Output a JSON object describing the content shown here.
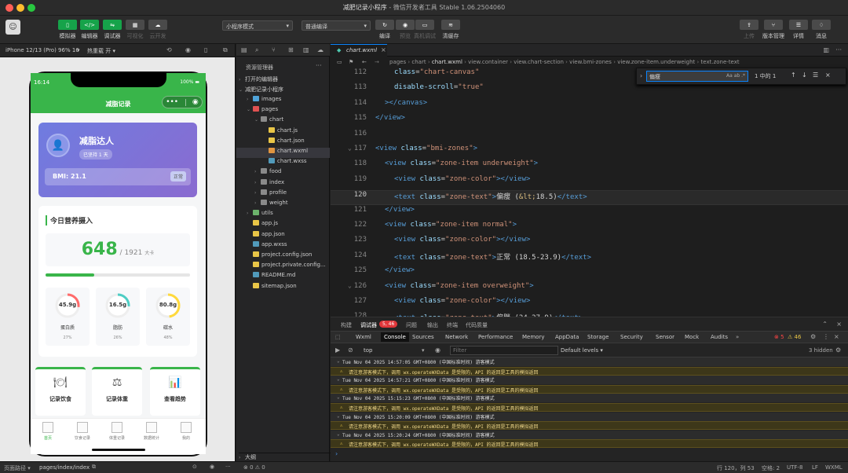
{
  "window": {
    "title": "减肥记录小程序",
    "subtitle": "微信开发者工具 Stable 1.06.2504060"
  },
  "toolbar": {
    "left": [
      {
        "label": "模拟器",
        "icon": "phone-icon",
        "active": true
      },
      {
        "label": "编辑器",
        "icon": "code-icon",
        "active": true
      },
      {
        "label": "调试器",
        "icon": "debug-icon",
        "active": true
      },
      {
        "label": "可视化",
        "icon": "layout-icon",
        "active": false
      },
      {
        "label": "云开发",
        "icon": "cloud-icon",
        "active": false
      }
    ],
    "mode_select": "小程序模式",
    "compile_select": "普通编译",
    "center": [
      {
        "label": "编译",
        "icon": "refresh-icon"
      },
      {
        "label": "预览",
        "icon": "eye-icon"
      },
      {
        "label": "真机调试",
        "icon": "devices-icon"
      },
      {
        "label": "清缓存",
        "icon": "layers-icon"
      }
    ],
    "right": [
      {
        "label": "上传",
        "icon": "upload-icon"
      },
      {
        "label": "版本管理",
        "icon": "branch-icon"
      },
      {
        "label": "详情",
        "icon": "menu-icon"
      },
      {
        "label": "消息",
        "icon": "bell-icon"
      }
    ]
  },
  "simulator": {
    "device_label": "iPhone 12/13 (Pro) 96% 16",
    "hot_reload": "热重载 开",
    "status_time": "16:14",
    "battery": "100%",
    "nav_title": "减脂记录",
    "profile": {
      "name": "减脂达人",
      "days": "已坚持 1 天",
      "bmi": "BMI: 21.1",
      "bmi_status": "正常"
    },
    "nutrition": {
      "title": "今日营养摄入",
      "calories": "648",
      "calorie_target": "/ 1921",
      "calorie_unit": "大卡",
      "progress": 0.337,
      "macros": [
        {
          "value": "45.9g",
          "name": "蛋白质",
          "pct": "27%",
          "ratio": 0.27,
          "color": "#ff6b6b"
        },
        {
          "value": "16.5g",
          "name": "脂肪",
          "pct": "26%",
          "ratio": 0.26,
          "color": "#4ecdc4"
        },
        {
          "value": "80.8g",
          "name": "碳水",
          "pct": "48%",
          "ratio": 0.48,
          "color": "#ffd93d"
        }
      ]
    },
    "shortcuts": [
      {
        "label": "记录饮食",
        "icon": "plate-icon"
      },
      {
        "label": "记录体重",
        "icon": "scale-icon"
      },
      {
        "label": "查看趋势",
        "icon": "bar-chart-icon"
      }
    ],
    "tabs": [
      "首页",
      "饮食记录",
      "体重记录",
      "数据统计",
      "我的"
    ]
  },
  "explorer": {
    "title": "资源管理器",
    "open_editors": "打开的编辑器",
    "project": "减肥记录小程序",
    "tree": [
      {
        "label": "images",
        "depth": 1,
        "kind": "folder-closed",
        "color": "#4fa3d8"
      },
      {
        "label": "pages",
        "depth": 1,
        "kind": "folder-open",
        "color": "#e05252"
      },
      {
        "label": "chart",
        "depth": 2,
        "kind": "folder-open",
        "color": "#8a8a8a"
      },
      {
        "label": "chart.js",
        "depth": 3,
        "kind": "file",
        "color": "#e8c547"
      },
      {
        "label": "chart.json",
        "depth": 3,
        "kind": "file",
        "color": "#e8c547"
      },
      {
        "label": "chart.wxml",
        "depth": 3,
        "kind": "file",
        "color": "#e09540",
        "selected": true
      },
      {
        "label": "chart.wxss",
        "depth": 3,
        "kind": "file",
        "color": "#519aba"
      },
      {
        "label": "food",
        "depth": 2,
        "kind": "folder-closed",
        "color": "#8a8a8a"
      },
      {
        "label": "index",
        "depth": 2,
        "kind": "folder-closed",
        "color": "#8a8a8a"
      },
      {
        "label": "profile",
        "depth": 2,
        "kind": "folder-closed",
        "color": "#8a8a8a"
      },
      {
        "label": "weight",
        "depth": 2,
        "kind": "folder-closed",
        "color": "#8a8a8a"
      },
      {
        "label": "utils",
        "depth": 1,
        "kind": "folder-closed",
        "color": "#6cb36c"
      },
      {
        "label": "app.js",
        "depth": 1,
        "kind": "file",
        "color": "#e8c547"
      },
      {
        "label": "app.json",
        "depth": 1,
        "kind": "file",
        "color": "#e8c547"
      },
      {
        "label": "app.wxss",
        "depth": 1,
        "kind": "file",
        "color": "#519aba"
      },
      {
        "label": "project.config.json",
        "depth": 1,
        "kind": "file",
        "color": "#e8c547"
      },
      {
        "label": "project.private.config...",
        "depth": 1,
        "kind": "file",
        "color": "#e8c547"
      },
      {
        "label": "README.md",
        "depth": 1,
        "kind": "file",
        "color": "#519aba"
      },
      {
        "label": "sitemap.json",
        "depth": 1,
        "kind": "file",
        "color": "#e8c547"
      }
    ],
    "outline": "大纲",
    "problems": "⊗ 0 ⚠ 0"
  },
  "editor": {
    "tab": "chart.wxml",
    "breadcrumb": [
      "pages",
      "chart",
      "chart.wxml",
      "view.container",
      "view.chart-section",
      "view.bmi-zones",
      "view.zone-item.underweight",
      "text.zone-text"
    ],
    "find_query": "偏瘦",
    "find_result": "1 中的 1",
    "lines": [
      {
        "n": "112",
        "html": "<span class=\"att\">class</span>=<span class=\"str\">\"chart-canvas\"</span>",
        "indent": 4
      },
      {
        "n": "113",
        "html": "<span class=\"att\">disable-scroll</span>=<span class=\"str\">\"true\"</span>",
        "indent": 4
      },
      {
        "n": "114",
        "html": "<span class=\"tag\">&gt;&lt;/canvas&gt;</span>",
        "indent": 2
      },
      {
        "n": "115",
        "html": "<span class=\"tag\">&lt;/view&gt;</span>",
        "indent": 0
      },
      {
        "n": "116",
        "html": "",
        "indent": 0
      },
      {
        "n": "117",
        "html": "<span class=\"tag\">&lt;view</span> <span class=\"att\">class</span>=<span class=\"str\">\"bmi-zones\"</span><span class=\"tag\">&gt;</span>",
        "indent": 0
      },
      {
        "n": "118",
        "html": "<span class=\"tag\">&lt;view</span> <span class=\"att\">class</span>=<span class=\"str\">\"zone-item underweight\"</span><span class=\"tag\">&gt;</span>",
        "indent": 2
      },
      {
        "n": "119",
        "html": "<span class=\"tag\">&lt;view</span> <span class=\"att\">class</span>=<span class=\"str\">\"zone-color\"</span><span class=\"tag\">&gt;&lt;/view&gt;</span>",
        "indent": 4
      },
      {
        "n": "120",
        "html": "<span class=\"tag\">&lt;text</span> <span class=\"att\">class</span>=<span class=\"str\">\"zone-text\"</span><span class=\"tag\">&gt;</span><span class=\"txt\">偏瘦 (</span><span class=\"ent\">&amp;lt;</span><span class=\"txt\">18.5)</span><span class=\"tag\">&lt;/text&gt;</span>",
        "indent": 4,
        "current": true
      },
      {
        "n": "121",
        "html": "<span class=\"tag\">&lt;/view&gt;</span>",
        "indent": 2
      },
      {
        "n": "122",
        "html": "<span class=\"tag\">&lt;view</span> <span class=\"att\">class</span>=<span class=\"str\">\"zone-item normal\"</span><span class=\"tag\">&gt;</span>",
        "indent": 2
      },
      {
        "n": "123",
        "html": "<span class=\"tag\">&lt;view</span> <span class=\"att\">class</span>=<span class=\"str\">\"zone-color\"</span><span class=\"tag\">&gt;&lt;/view&gt;</span>",
        "indent": 4
      },
      {
        "n": "124",
        "html": "<span class=\"tag\">&lt;text</span> <span class=\"att\">class</span>=<span class=\"str\">\"zone-text\"</span><span class=\"tag\">&gt;</span><span class=\"txt\">正常 (18.5-23.9)</span><span class=\"tag\">&lt;/text&gt;</span>",
        "indent": 4
      },
      {
        "n": "125",
        "html": "<span class=\"tag\">&lt;/view&gt;</span>",
        "indent": 2
      },
      {
        "n": "126",
        "html": "<span class=\"tag\">&lt;view</span> <span class=\"att\">class</span>=<span class=\"str\">\"zone-item overweight\"</span><span class=\"tag\">&gt;</span>",
        "indent": 2
      },
      {
        "n": "127",
        "html": "<span class=\"tag\">&lt;view</span> <span class=\"att\">class</span>=<span class=\"str\">\"zone-color\"</span><span class=\"tag\">&gt;&lt;/view&gt;</span>",
        "indent": 4
      },
      {
        "n": "128",
        "html": "<span class=\"tag\">&lt;text</span> <span class=\"att\">class</span>=<span class=\"str\">\"zone-text\"</span><span class=\"tag\">&gt;</span><span class=\"txt\">偏胖 (24-27.9)</span><span class=\"tag\">&lt;/text&gt;</span>",
        "indent": 4
      }
    ]
  },
  "devtools": {
    "top_tabs": [
      "构建",
      "调试器",
      "问题",
      "输出",
      "终端",
      "代码质量"
    ],
    "badge": "5, 46",
    "panel_tabs": [
      "Wxml",
      "Console",
      "Sources",
      "Network",
      "Performance",
      "Memory",
      "AppData",
      "Storage",
      "Security",
      "Sensor",
      "Mock",
      "Audits"
    ],
    "errors": "5",
    "warnings": "46",
    "context": "top",
    "filter_placeholder": "Filter",
    "levels": "Default levels ▾",
    "hidden": "3 hidden",
    "logs": [
      {
        "type": "date",
        "text": "Tue Nov 04 2025 14:57:05 GMT+0800 (中国标准时间) 游客模式"
      },
      {
        "type": "warn",
        "text": "请注意游客模式下，调用 wx.operateWXData 是受限的，API 的返回是工具的模拟返回"
      },
      {
        "type": "date",
        "text": "Tue Nov 04 2025 14:57:21 GMT+0800 (中国标准时间) 游客模式"
      },
      {
        "type": "warn",
        "text": "请注意游客模式下，调用 wx.operateWXData 是受限的，API 的返回是工具的模拟返回"
      },
      {
        "type": "date",
        "text": "Tue Nov 04 2025 15:15:23 GMT+0800 (中国标准时间) 游客模式"
      },
      {
        "type": "warn",
        "text": "请注意游客模式下，调用 wx.operateWXData 是受限的，API 的返回是工具的模拟返回"
      },
      {
        "type": "date",
        "text": "Tue Nov 04 2025 15:20:09 GMT+0800 (中国标准时间) 游客模式"
      },
      {
        "type": "warn",
        "text": "请注意游客模式下，调用 wx.operateWXData 是受限的，API 的返回是工具的模拟返回"
      },
      {
        "type": "date",
        "text": "Tue Nov 04 2025 15:20:24 GMT+0800 (中国标准时间) 游客模式"
      },
      {
        "type": "warn",
        "text": "请注意游客模式下，调用 wx.operateWXData 是受限的，API 的返回是工具的模拟返回"
      }
    ]
  },
  "statusbar": {
    "page_path_label": "页面路径",
    "page_path": "pages/index/index",
    "cursor": "行 120，列 53",
    "spaces": "空格: 2",
    "encoding": "UTF-8",
    "eol": "LF",
    "language": "WXML"
  }
}
